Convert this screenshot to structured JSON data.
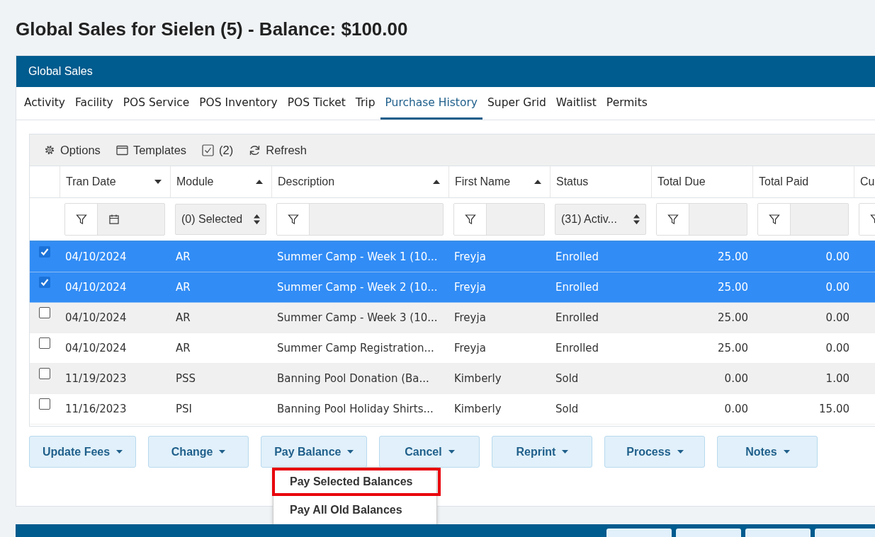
{
  "page_title": "Global Sales for Sielen (5) - Balance: $100.00",
  "panel": {
    "title": "Global Sales"
  },
  "tabs": [
    {
      "label": "Activity",
      "selected": false
    },
    {
      "label": "Facility",
      "selected": false
    },
    {
      "label": "POS Service",
      "selected": false
    },
    {
      "label": "POS Inventory",
      "selected": false
    },
    {
      "label": "POS Ticket",
      "selected": false
    },
    {
      "label": "Trip",
      "selected": false
    },
    {
      "label": "Purchase History",
      "selected": true
    },
    {
      "label": "Super Grid",
      "selected": false
    },
    {
      "label": "Waitlist",
      "selected": false
    },
    {
      "label": "Permits",
      "selected": false
    }
  ],
  "grid_toolbar": [
    {
      "kind": "options",
      "label": "Options"
    },
    {
      "kind": "templates",
      "label": "Templates"
    },
    {
      "kind": "checked",
      "label": "(2)"
    },
    {
      "kind": "refresh",
      "label": "Refresh"
    }
  ],
  "columns": [
    {
      "label": "Tran Date",
      "sort_descending": true,
      "filter": {
        "kind": "date"
      }
    },
    {
      "label": "Module",
      "sort_descending": false,
      "filter": {
        "kind": "select",
        "value": "(0) Selected"
      }
    },
    {
      "label": "Description",
      "sort_descending": false,
      "filter": {
        "kind": "text"
      }
    },
    {
      "label": "First Name",
      "sort_descending": false,
      "filter": {
        "kind": "text"
      }
    },
    {
      "label": "Status",
      "filter": {
        "kind": "select",
        "value": "(31) Activ..."
      }
    },
    {
      "label": "Total Due",
      "filter": {
        "kind": "text"
      }
    },
    {
      "label": "Total Paid",
      "filter": {
        "kind": "text"
      }
    },
    {
      "label": "Cu",
      "filter": {
        "kind": "text"
      }
    }
  ],
  "rows": [
    {
      "selected": true,
      "cells": [
        "04/10/2024",
        "AR",
        "Summer Camp - Week 1 (10...",
        "Freyja",
        "Enrolled",
        "25.00",
        "0.00"
      ]
    },
    {
      "selected": true,
      "cells": [
        "04/10/2024",
        "AR",
        "Summer Camp - Week 2 (10...",
        "Freyja",
        "Enrolled",
        "25.00",
        "0.00"
      ]
    },
    {
      "selected": false,
      "cells": [
        "04/10/2024",
        "AR",
        "Summer Camp - Week 3 (10...",
        "Freyja",
        "Enrolled",
        "25.00",
        "0.00"
      ]
    },
    {
      "selected": false,
      "cells": [
        "04/10/2024",
        "AR",
        "Summer Camp Registration...",
        "Freyja",
        "Enrolled",
        "25.00",
        "0.00"
      ]
    },
    {
      "selected": false,
      "cells": [
        "11/19/2023",
        "PSS",
        "Banning Pool Donation (Ba...",
        "Kimberly",
        "Sold",
        "0.00",
        "1.00"
      ]
    },
    {
      "selected": false,
      "cells": [
        "11/16/2023",
        "PSI",
        "Banning Pool Holiday Shirts...",
        "Kimberly",
        "Sold",
        "0.00",
        "15.00"
      ]
    }
  ],
  "action_buttons": [
    {
      "label": "Update Fees"
    },
    {
      "label": "Change"
    },
    {
      "label": "Pay Balance"
    },
    {
      "label": "Cancel"
    },
    {
      "label": "Reprint"
    },
    {
      "label": "Process"
    },
    {
      "label": "Notes"
    }
  ],
  "dropdown_items": [
    {
      "label": "Pay Selected Balances",
      "highlighted": true
    },
    {
      "label": "Pay All Old Balances",
      "highlighted": false
    }
  ]
}
